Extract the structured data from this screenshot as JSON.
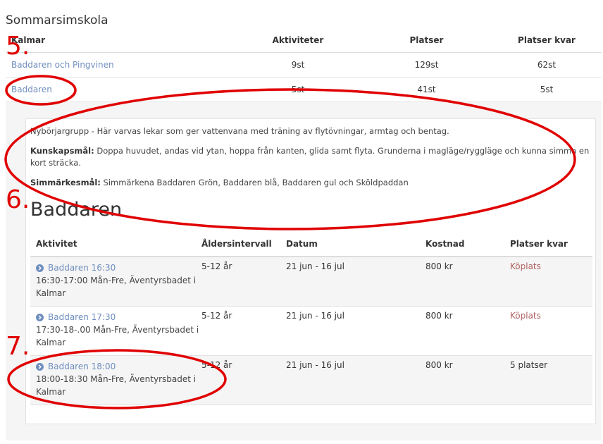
{
  "page": {
    "title": "Sommarsimskola"
  },
  "top_table": {
    "headers": [
      "Kalmar",
      "Aktiviteter",
      "Platser",
      "Platser kvar"
    ],
    "rows": [
      [
        "Baddaren och Pingvinen",
        "9st",
        "129st",
        "62st"
      ],
      [
        "Baddaren",
        "5st",
        "41st",
        "5st"
      ]
    ]
  },
  "detail": {
    "intro": "Nybörjargrupp - Här varvas lekar som ger vattenvana med träning av flytövningar, armtag och bentag.",
    "kunskap_label": "Kunskapsmål:",
    "kunskap_text": " Doppa huvudet, andas vid ytan, hoppa från kanten, glida samt flyta. Grunderna i magläge/ryggläge och kunna simma en kort sträcka.",
    "simmarke_label": "Simmärkesmål:",
    "simmarke_text": " Simmärkena Baddaren Grön, Baddaren blå, Baddaren gul och Sköldpaddan",
    "title": "Baddaren"
  },
  "activities": {
    "headers": [
      "Aktivitet",
      "Åldersintervall",
      "Datum",
      "Kostnad",
      "Platser kvar"
    ],
    "rows": [
      {
        "name": "Baddaren 16:30",
        "line2": "16:30-17:00 Mån-Fre, Äventyrsbadet i",
        "line3": "Kalmar",
        "age": "5-12 år",
        "date": "21 jun - 16 jul",
        "cost": "800 kr",
        "left": "Köplats"
      },
      {
        "name": "Baddaren 17:30",
        "line2": "17:30-18-.00 Mån-Fre, Äventyrsbadet i",
        "line3": "Kalmar",
        "age": "5-12 år",
        "date": "21 jun - 16 jul",
        "cost": "800 kr",
        "left": "Köplats"
      },
      {
        "name": "Baddaren 18:00",
        "line2": "18:00-18:30 Mån-Fre, Äventyrsbadet i",
        "line3": "Kalmar",
        "age": "5-12 år",
        "date": "21 jun - 16 jul",
        "cost": "800 kr",
        "left": "5 platser"
      }
    ]
  },
  "annotations": {
    "a5": "5.",
    "a6": "6.",
    "a7": "7."
  }
}
